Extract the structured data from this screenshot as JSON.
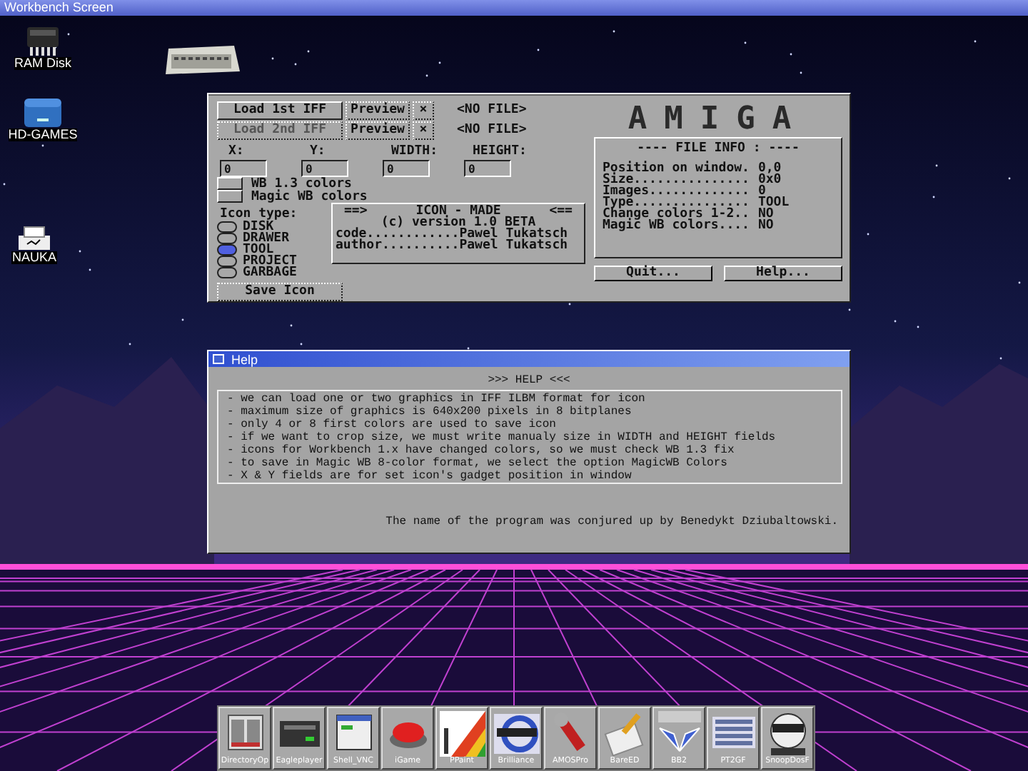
{
  "screen": {
    "title": "Workbench Screen"
  },
  "desktop_icons": [
    {
      "label": "RAM Disk",
      "kind": "chip"
    },
    {
      "label": "HD-GAMES",
      "kind": "drive"
    },
    {
      "label": "NAUKA",
      "kind": "printer"
    },
    {
      "kind": "computer"
    }
  ],
  "main_window": {
    "load_rows": [
      {
        "button": "Load 1st IFF",
        "disabled": false,
        "preview": "Preview",
        "clear": "×",
        "file": "<NO FILE>"
      },
      {
        "button": "Load 2nd IFF",
        "disabled": true,
        "preview": "Preview",
        "clear": "×",
        "file": "<NO FILE>"
      }
    ],
    "coords": [
      {
        "label": "X:",
        "value": "0"
      },
      {
        "label": "Y:",
        "value": "0"
      },
      {
        "label": "WIDTH:",
        "value": "0"
      },
      {
        "label": "HEIGHT:",
        "value": "0"
      }
    ],
    "checkboxes": [
      {
        "label": "WB 1.3 colors",
        "checked": false
      },
      {
        "label": "Magic WB colors",
        "checked": false
      }
    ],
    "icon_type": {
      "label": "Icon type:",
      "options": [
        {
          "label": "DISK",
          "selected": false
        },
        {
          "label": "DRAWER",
          "selected": false
        },
        {
          "label": "TOOL",
          "selected": true
        },
        {
          "label": "PROJECT",
          "selected": false
        },
        {
          "label": "GARBAGE",
          "selected": false
        }
      ]
    },
    "about": {
      "left": "==>",
      "heading": "ICON - MADE",
      "right": "<==",
      "version": "(c) version 1.0 BETA",
      "credits": [
        "code............Pawel Tukatsch",
        "author..........Pawel Tukatsch"
      ]
    },
    "save_button": "Save Icon",
    "logo": "AMIGA",
    "file_info": {
      "title": "---- FILE INFO : ----",
      "rows": [
        {
          "label": "Position on window.",
          "value": "0,0"
        },
        {
          "label": "Size...............",
          "value": "0x0"
        },
        {
          "label": "Images.............",
          "value": "0"
        },
        {
          "label": "Type...............",
          "value": "TOOL"
        },
        {
          "label": "Change colors 1-2..",
          "value": "NO"
        },
        {
          "label": "Magic WB colors....",
          "value": "NO"
        }
      ]
    },
    "buttons": [
      "Quit...",
      "Help..."
    ]
  },
  "help_window": {
    "title": "Help",
    "heading": ">>> HELP <<<",
    "lines": [
      "- we can load one or two graphics in IFF ILBM format for icon",
      "- maximum size of graphics is 640x200 pixels in 8 bitplanes",
      "- only 4 or 8 first colors are used to save icon",
      "- if we want to crop size, we must write manualy size in WIDTH and HEIGHT fields",
      "- icons for Workbench 1.x have changed colors, so we must check WB 1.3 fix",
      "- to save in Magic WB 8-color format, we select the option MagicWB Colors",
      "- X & Y fields are for set icon's gadget position in window"
    ],
    "footer": "The name of the program was conjured up by Benedykt Dziubaltowski."
  },
  "dock": [
    {
      "label": "DirectoryOp",
      "kind": "panel"
    },
    {
      "label": "Eagleplayer",
      "kind": "device"
    },
    {
      "label": "Shell_VNC",
      "kind": "window"
    },
    {
      "label": "iGame",
      "kind": "button"
    },
    {
      "label": "PPaint",
      "kind": "paint"
    },
    {
      "label": "Brilliance",
      "kind": "logo"
    },
    {
      "label": "AMOSPro",
      "kind": "wrench"
    },
    {
      "label": "BareED",
      "kind": "pencil"
    },
    {
      "label": "BB2",
      "kind": "wings"
    },
    {
      "label": "PT2GF",
      "kind": "grid"
    },
    {
      "label": "SnoopDosF",
      "kind": "mascot"
    }
  ]
}
